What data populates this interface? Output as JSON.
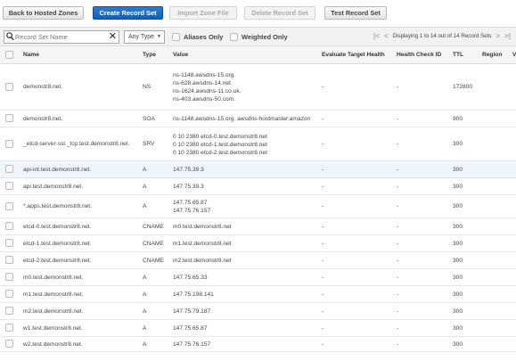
{
  "toolbar": {
    "back": "Back to Hosted Zones",
    "create": "Create Record Set",
    "import": "Import Zone File",
    "delete": "Delete Record Set",
    "test": "Test Record Set"
  },
  "filter": {
    "search_placeholder": "Record Set Name",
    "search_value": "",
    "type_select": "Any Type",
    "aliases_only": "Aliases Only",
    "weighted_only": "Weighted Only",
    "pager_text": "Displaying 1 to 14 out of 14 Record Sets"
  },
  "columns": {
    "name": "Name",
    "type": "Type",
    "value": "Value",
    "evaluate": "Evaluate Target Health",
    "health": "Health Check ID",
    "ttl": "TTL",
    "region": "Region",
    "extra": "V"
  },
  "rows": [
    {
      "name": "demonstr8.net.",
      "type": "NS",
      "values": [
        "ns-1148.awsdns-15.org.",
        "ns-628.awsdns-14.net.",
        "ns-1624.awsdns-11.co.uk.",
        "ns-403.awsdns-50.com."
      ],
      "evaluate": "-",
      "health": "-",
      "ttl": "172800"
    },
    {
      "name": "demonstr8.net.",
      "type": "SOA",
      "values": [
        "ns-1148.awsdns-15.org. awsdns-hostmaster.amazon"
      ],
      "evaluate": "-",
      "health": "-",
      "ttl": "900"
    },
    {
      "name": "_etcd-server-ssl._tcp.test.demonstr8.net.",
      "type": "SRV",
      "values": [
        "0 10 2380 etcd-0.test.demonstr8.net",
        "0 10 2380 etcd-1.test.demonstr8.net",
        "0 10 2380 etcd-2.test.demonstr8.net"
      ],
      "evaluate": "-",
      "health": "-",
      "ttl": "300"
    },
    {
      "name": "api-int.test.demonstr8.net.",
      "type": "A",
      "values": [
        "147.75.39.3"
      ],
      "evaluate": "-",
      "health": "-",
      "ttl": "300"
    },
    {
      "name": "api.test.demonstr8.net.",
      "type": "A",
      "values": [
        "147.75.39.3"
      ],
      "evaluate": "-",
      "health": "-",
      "ttl": "300"
    },
    {
      "name": "*.apps.test.demonstr8.net.",
      "type": "A",
      "values": [
        "147.75.65.87",
        "147.75.76.157"
      ],
      "evaluate": "-",
      "health": "-",
      "ttl": "300"
    },
    {
      "name": "etcd-0.test.demonstr8.net.",
      "type": "CNAME",
      "values": [
        "m0.test.demonstr8.net"
      ],
      "evaluate": "-",
      "health": "-",
      "ttl": "300"
    },
    {
      "name": "etcd-1.test.demonstr8.net.",
      "type": "CNAME",
      "values": [
        "m1.test.demonstr8.net"
      ],
      "evaluate": "-",
      "health": "-",
      "ttl": "300"
    },
    {
      "name": "etcd-2.test.demonstr8.net.",
      "type": "CNAME",
      "values": [
        "m2.test.demonstr8.net"
      ],
      "evaluate": "-",
      "health": "-",
      "ttl": "300"
    },
    {
      "name": "m0.test.demonstr8.net.",
      "type": "A",
      "values": [
        "147.75.65.33"
      ],
      "evaluate": "-",
      "health": "-",
      "ttl": "300"
    },
    {
      "name": "m1.test.demonstr8.net.",
      "type": "A",
      "values": [
        "147.75.198.141"
      ],
      "evaluate": "-",
      "health": "-",
      "ttl": "300"
    },
    {
      "name": "m2.test.demonstr8.net.",
      "type": "A",
      "values": [
        "147.75.79.187"
      ],
      "evaluate": "-",
      "health": "-",
      "ttl": "300"
    },
    {
      "name": "w1.test.demonstr8.net.",
      "type": "A",
      "values": [
        "147.75.65.87"
      ],
      "evaluate": "-",
      "health": "-",
      "ttl": "300"
    },
    {
      "name": "w2.test.demonstr8.net.",
      "type": "A",
      "values": [
        "147.75.76.157"
      ],
      "evaluate": "-",
      "health": "-",
      "ttl": "300"
    }
  ],
  "colors": {
    "primary": "#1a6dc8",
    "selected_row": "#eef5fc"
  }
}
